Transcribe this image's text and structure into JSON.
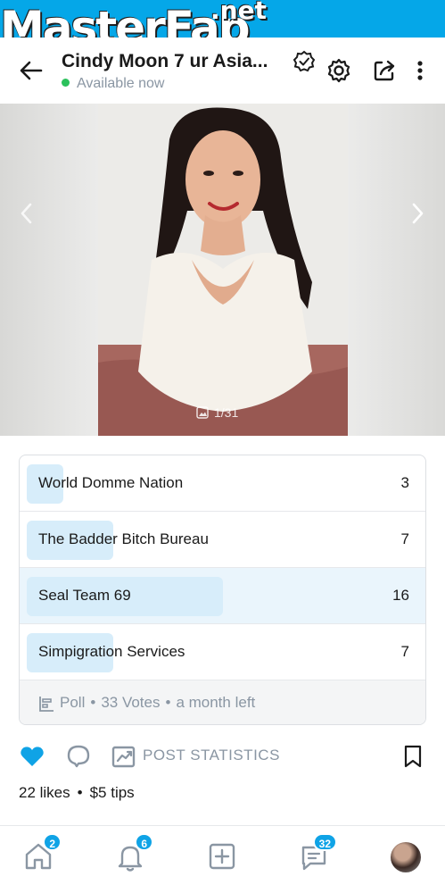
{
  "watermark": {
    "brand": "MasterFap",
    "tld": ".net"
  },
  "header": {
    "title": "Cindy Moon 7 ur Asia...",
    "presence": "Available now"
  },
  "media": {
    "counter": "1/31"
  },
  "poll": {
    "options": [
      {
        "label": "World Domme Nation",
        "votes": "3",
        "share": 0.09
      },
      {
        "label": "The Badder Bitch Bureau",
        "votes": "7",
        "share": 0.21
      },
      {
        "label": "Seal Team 69",
        "votes": "16",
        "share": 0.48,
        "selected": true
      },
      {
        "label": "Simpigration Services",
        "votes": "7",
        "share": 0.21
      }
    ],
    "type_label": "Poll",
    "votes_label": "33 Votes",
    "time_left": "a month left"
  },
  "actions": {
    "stats_label": "POST STATISTICS"
  },
  "engagement": {
    "likes": "22 likes",
    "tips": "$5 tips"
  },
  "nav": {
    "home_badge": "2",
    "notifications_badge": "6",
    "messages_badge": "32"
  },
  "colors": {
    "accent": "#00aff0",
    "like": "#0fa3e6",
    "muted": "#8a96a3",
    "online": "#2bc15c"
  }
}
